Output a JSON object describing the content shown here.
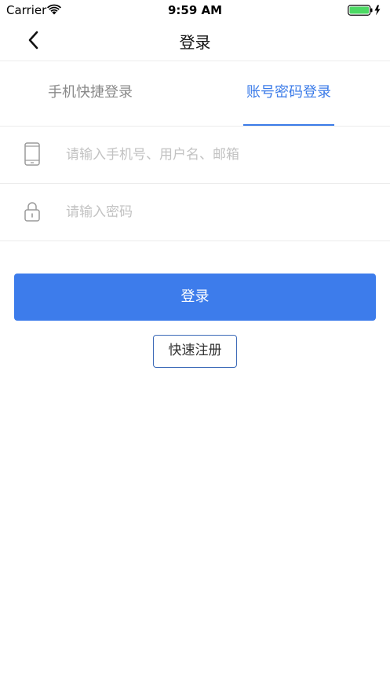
{
  "status_bar": {
    "carrier": "Carrier",
    "time": "9:59 AM",
    "wifi_icon": "wifi-icon",
    "battery_icon": "battery-charging-icon"
  },
  "nav": {
    "title": "登录",
    "back_icon": "chevron-left-icon"
  },
  "tabs": [
    {
      "label": "手机快捷登录",
      "active": false
    },
    {
      "label": "账号密码登录",
      "active": true
    }
  ],
  "form": {
    "username_placeholder": "请输入手机号、用户名、邮箱",
    "username_value": "",
    "password_placeholder": "请输入密码",
    "password_value": "",
    "username_icon": "phone-icon",
    "password_icon": "lock-icon"
  },
  "buttons": {
    "login_label": "登录",
    "register_label": "快速注册"
  },
  "colors": {
    "accent": "#3d7ceb",
    "tab_inactive": "#8a8a8a",
    "battery": "#4cd964"
  }
}
